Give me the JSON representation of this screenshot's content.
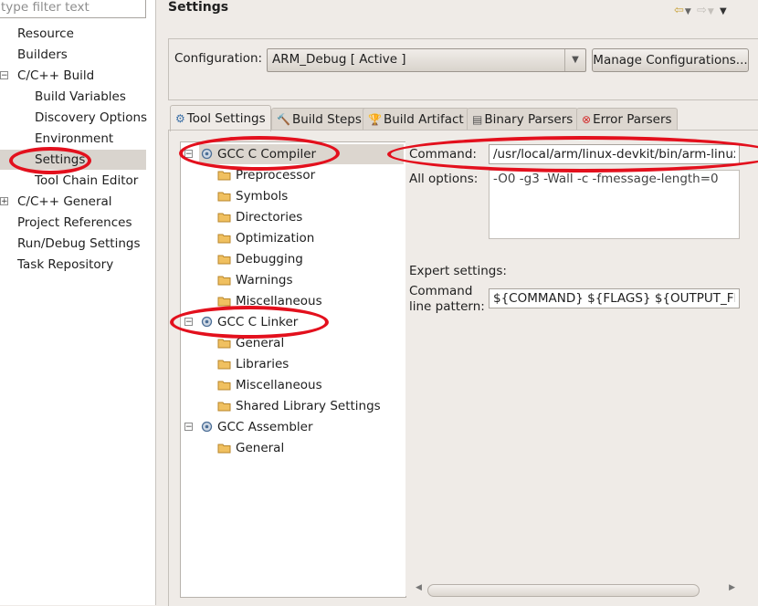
{
  "filter": {
    "placeholder": "type filter text"
  },
  "nav": {
    "items": [
      {
        "label": "Resource",
        "expander": ""
      },
      {
        "label": "Builders",
        "expander": ""
      },
      {
        "label": "C/C++ Build",
        "expander": "−"
      },
      {
        "label": "Build Variables",
        "expander": ""
      },
      {
        "label": "Discovery Options",
        "expander": ""
      },
      {
        "label": "Environment",
        "expander": ""
      },
      {
        "label": "Settings",
        "expander": "",
        "selected": true
      },
      {
        "label": "Tool Chain Editor",
        "expander": ""
      },
      {
        "label": "C/C++ General",
        "expander": "+"
      },
      {
        "label": "Project References",
        "expander": ""
      },
      {
        "label": "Run/Debug Settings",
        "expander": ""
      },
      {
        "label": "Task Repository",
        "expander": ""
      }
    ]
  },
  "header": {
    "title": "Settings",
    "nav_icons": [
      "back-arrow-icon",
      "forward-arrow-icon",
      "view-menu-icon"
    ]
  },
  "configuration": {
    "label": "Configuration:",
    "value": "ARM_Debug  [ Active ]",
    "manage_label": "Manage Configurations..."
  },
  "tabs": [
    {
      "label": "Tool Settings",
      "icon": "tool-settings-icon",
      "active": true
    },
    {
      "label": "Build Steps",
      "icon": "build-steps-icon"
    },
    {
      "label": "Build Artifact",
      "icon": "build-artifact-icon"
    },
    {
      "label": "Binary Parsers",
      "icon": "binary-parsers-icon"
    },
    {
      "label": "Error Parsers",
      "icon": "error-parsers-icon"
    }
  ],
  "tool_tree": [
    {
      "label": "GCC C Compiler",
      "type": "tool",
      "expander": "−",
      "selected": true
    },
    {
      "label": "Preprocessor",
      "type": "option"
    },
    {
      "label": "Symbols",
      "type": "option"
    },
    {
      "label": "Directories",
      "type": "option"
    },
    {
      "label": "Optimization",
      "type": "option"
    },
    {
      "label": "Debugging",
      "type": "option"
    },
    {
      "label": "Warnings",
      "type": "option"
    },
    {
      "label": "Miscellaneous",
      "type": "option"
    },
    {
      "label": "GCC C Linker",
      "type": "tool",
      "expander": "−"
    },
    {
      "label": "General",
      "type": "option"
    },
    {
      "label": "Libraries",
      "type": "option"
    },
    {
      "label": "Miscellaneous",
      "type": "option"
    },
    {
      "label": "Shared Library Settings",
      "type": "option"
    },
    {
      "label": "GCC Assembler",
      "type": "tool",
      "expander": "−"
    },
    {
      "label": "General",
      "type": "option"
    }
  ],
  "options": {
    "command_label": "Command:",
    "command_value": "/usr/local/arm/linux-devkit/bin/arm-linux-gnueabihf-gcc",
    "all_options_label": "All options:",
    "all_options_value": "-O0 -g3 -Wall -c -fmessage-length=0",
    "expert_label": "Expert settings:",
    "pattern_label_1": "Command",
    "pattern_label_2": "line pattern:",
    "pattern_value": "${COMMAND} ${FLAGS} ${OUTPUT_FLAG}${OUTPUT_PREFIX}${OUTPUT} ${INPUTS}"
  },
  "colors": {
    "annotation": "#e3101d",
    "selection": "#d9d4ce",
    "background": "#efebe7"
  }
}
